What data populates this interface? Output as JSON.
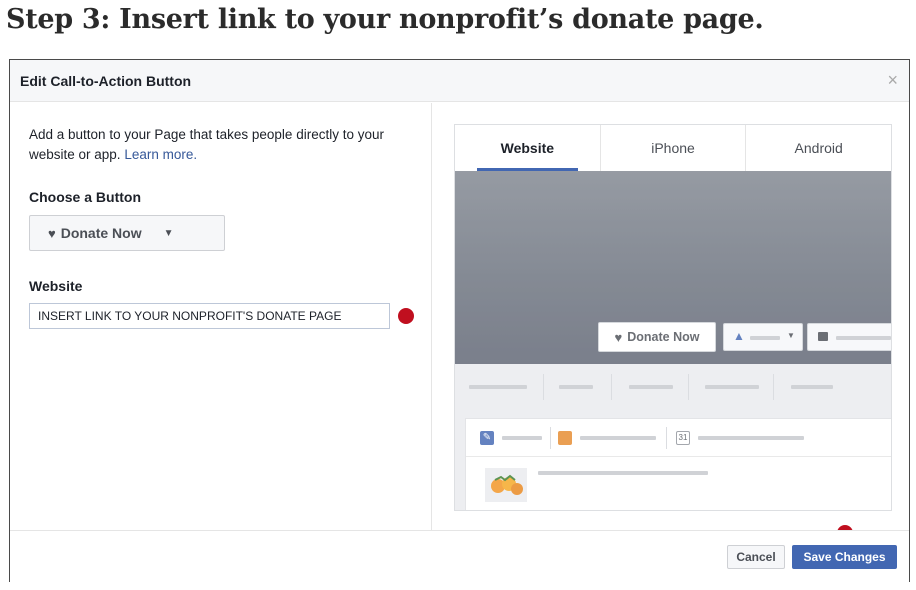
{
  "heading": "Step 3: Insert link to your nonprofit’s donate page.",
  "dialog": {
    "title": "Edit Call-to-Action Button",
    "close_glyph": "×"
  },
  "left": {
    "intro": "Add a button to your Page that takes people directly to your website or app.",
    "learn_more": "Learn more.",
    "choose_label": "Choose a Button",
    "button_choice": "Donate Now",
    "website_label": "Website",
    "website_value": "INSERT LINK TO YOUR NONPROFIT'S DONATE PAGE"
  },
  "preview": {
    "tabs": [
      {
        "label": "Website",
        "active": true
      },
      {
        "label": "iPhone",
        "active": false
      },
      {
        "label": "Android",
        "active": false
      }
    ],
    "donate_button": "Donate Now",
    "calendar_day": "31"
  },
  "footer": {
    "cancel": "Cancel",
    "save": "Save Changes"
  },
  "colors": {
    "accent": "#4267b2",
    "marker": "#c00f1f",
    "cover": "#6a717d"
  },
  "icons": [
    "heart-icon",
    "chevron-down-icon",
    "close-icon",
    "thumbs-up-icon",
    "message-icon",
    "pencil-icon",
    "photo-icon",
    "calendar-icon"
  ]
}
